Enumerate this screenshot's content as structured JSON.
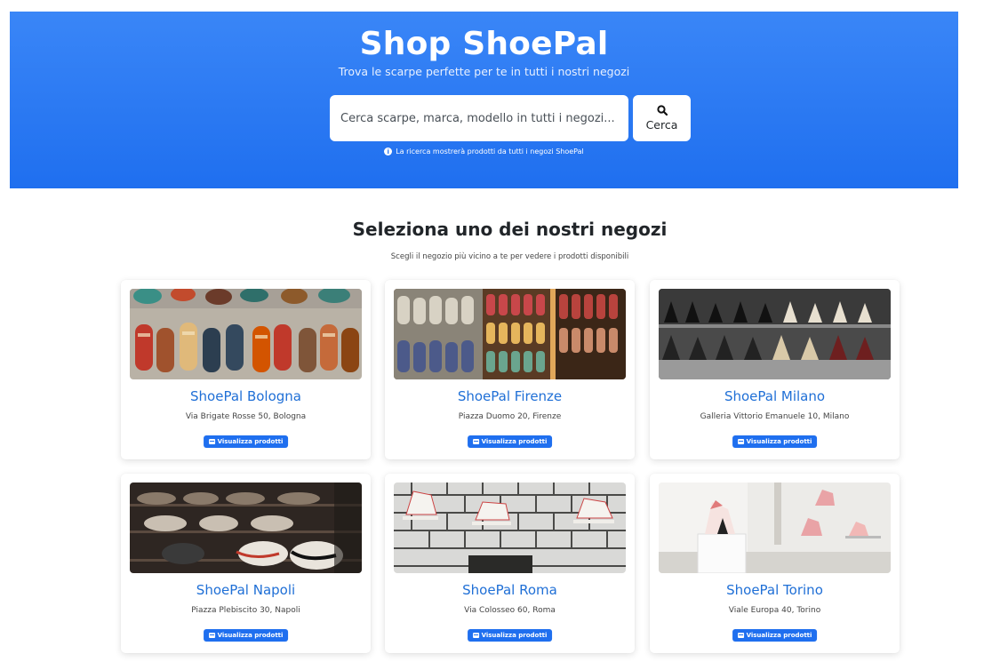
{
  "hero": {
    "title": "Shop ShoePal",
    "subtitle": "Trova le scarpe perfette per te in tutti i nostri negozi",
    "search_placeholder": "Cerca scarpe, marca, modello in tutti i negozi...",
    "search_button_label": "Cerca",
    "search_icon": "search-icon",
    "hint_icon": "info-icon",
    "hint": "La ricerca mostrerà prodotti da tutti i negozi ShoePal",
    "background_color": "#1f6fef"
  },
  "stores_section": {
    "title": "Seleziona uno dei nostri negozi",
    "subtitle": "Scegli il negozio più vicino a te per vedere i prodotti disponibili"
  },
  "stores": [
    {
      "name": "ShoePal Bologna",
      "address": "Via Brigate Rosse 50, Bologna",
      "button": "Visualizza prodotti",
      "image": "colorful-slippers-photo"
    },
    {
      "name": "ShoePal Firenze",
      "address": "Piazza Duomo 20, Firenze",
      "button": "Visualizza prodotti",
      "image": "shoe-shelves-photo"
    },
    {
      "name": "ShoePal Milano",
      "address": "Galleria Vittorio Emanuele 10, Milano",
      "button": "Visualizza prodotti",
      "image": "heels-display-photo"
    },
    {
      "name": "ShoePal Napoli",
      "address": "Piazza Plebiscito 30, Napoli",
      "button": "Visualizza prodotti",
      "image": "sneaker-wall-photo"
    },
    {
      "name": "ShoePal Roma",
      "address": "Via Colosseo 60, Roma",
      "button": "Visualizza prodotti",
      "image": "white-sneakers-tiles-photo"
    },
    {
      "name": "ShoePal Torino",
      "address": "Viale Europa 40, Torino",
      "button": "Visualizza prodotti",
      "image": "pink-heels-boutique-photo"
    }
  ],
  "colors": {
    "accent": "#1f6fef",
    "store_name": "#1f6fd6"
  }
}
